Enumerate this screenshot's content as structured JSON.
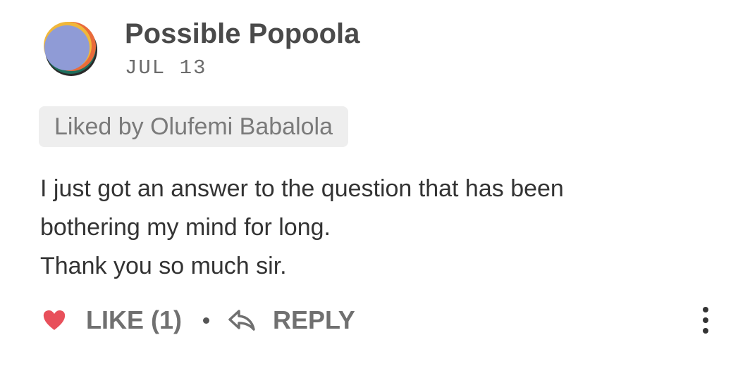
{
  "comment": {
    "author": "Possible Popoola",
    "date": "JUL 13",
    "liked_by": "Liked by Olufemi Babalola",
    "body_lines": [
      "I just got an answer to the question that has been",
      "bothering my mind for long.",
      "Thank you so much sir."
    ],
    "actions": {
      "like_label": "LIKE (1)",
      "reply_label": "REPLY"
    }
  },
  "icons": {
    "like": "heart-icon",
    "reply": "reply-arrow-icon",
    "more": "more-vertical-icon"
  },
  "colors": {
    "heart": "#e8505b",
    "avatar_main": "#8f9bd6",
    "avatar_yellow": "#f0b73a",
    "avatar_orange": "#e96b3b",
    "avatar_green": "#1f6e5c",
    "avatar_dark": "#2a2a2a"
  }
}
